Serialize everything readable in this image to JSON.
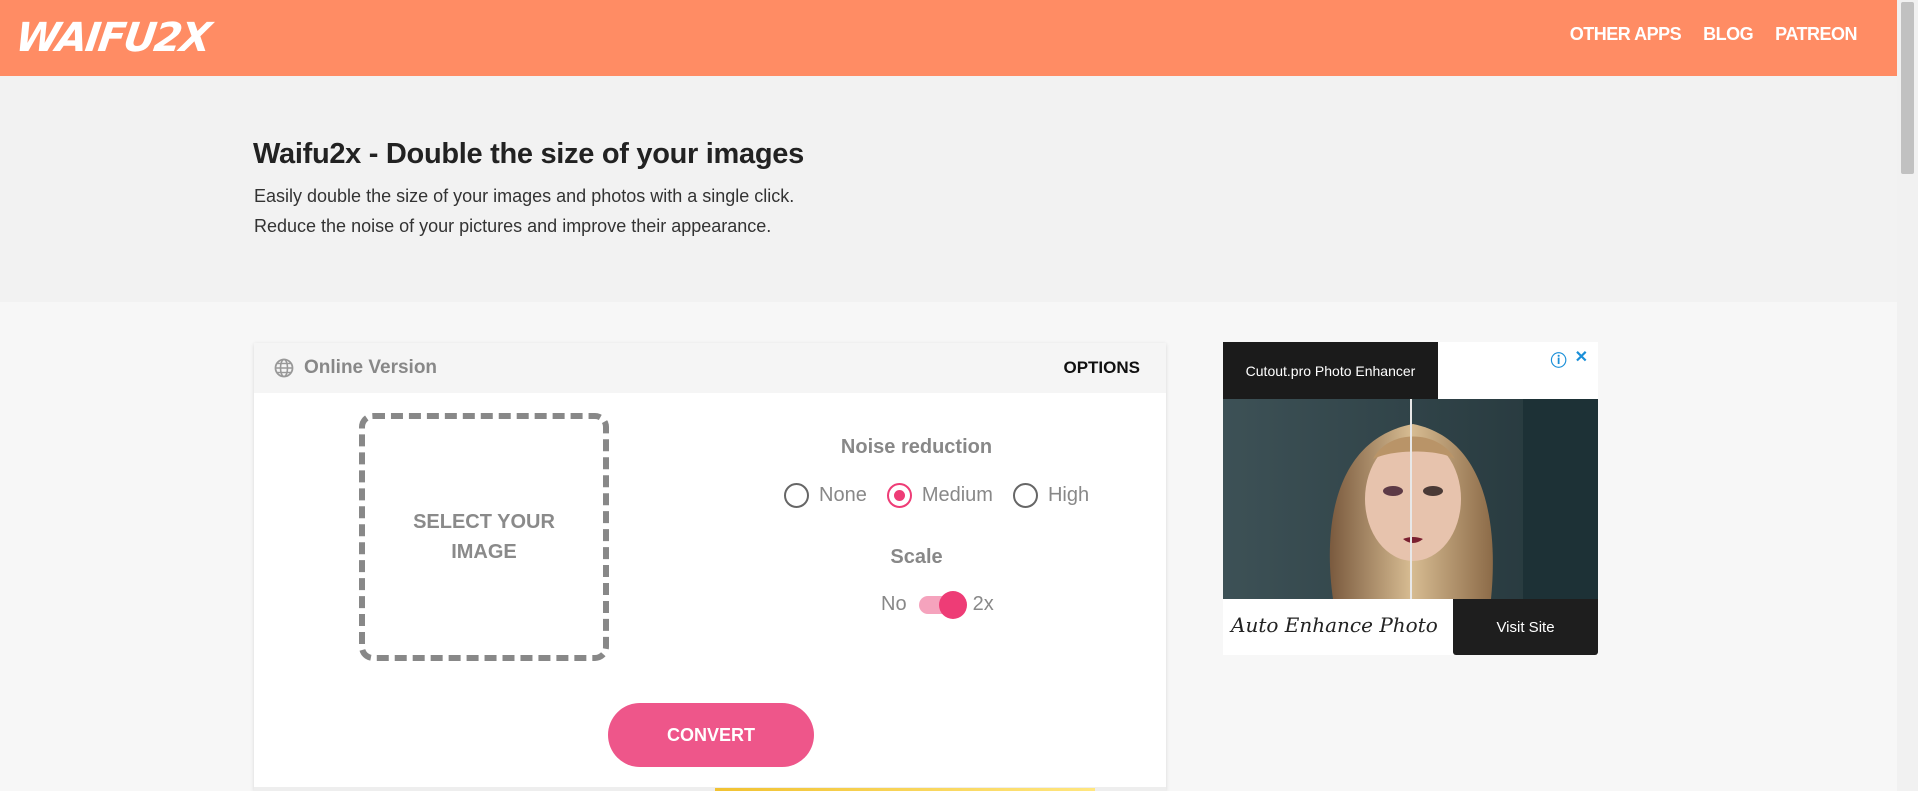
{
  "header": {
    "logo": "WAIFU2X",
    "nav": [
      "OTHER APPS",
      "BLOG",
      "PATREON"
    ],
    "bg_color": "#ff8c64"
  },
  "hero": {
    "title": "Waifu2x - Double the size of your images",
    "line1": "Easily double the size of your images and photos with a single click.",
    "line2": "Reduce the noise of your pictures and improve their appearance."
  },
  "card": {
    "version_label": "Online Version",
    "options_label": "OPTIONS",
    "dropzone_label": "SELECT YOUR IMAGE",
    "noise_title": "Noise reduction",
    "noise_options": [
      "None",
      "Medium",
      "High"
    ],
    "noise_selected": "Medium",
    "scale_title": "Scale",
    "scale_no": "No",
    "scale_yes": "2x",
    "scale_enabled": true,
    "convert_label": "CONVERT",
    "accent_color": "#ee3c76"
  },
  "ad": {
    "title": "Cutout.pro Photo Enhancer",
    "tagline": "Auto Enhance Photo",
    "visit_label": "Visit Site",
    "info_icon": "info-icon",
    "close_icon": "close-icon"
  }
}
